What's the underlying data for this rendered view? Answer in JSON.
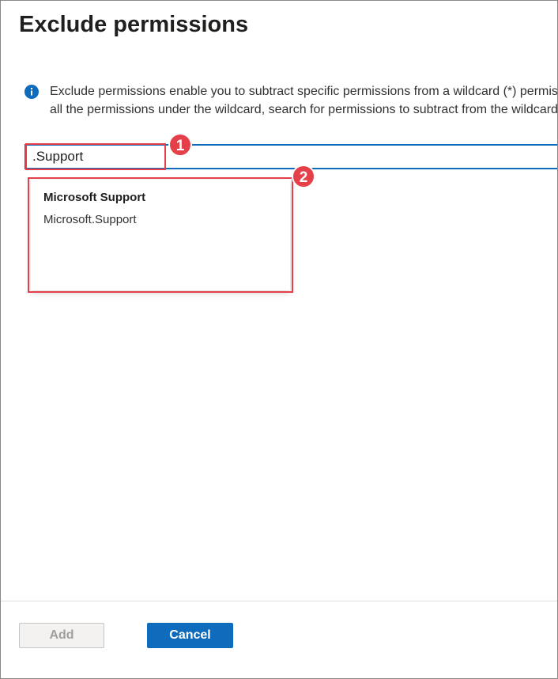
{
  "panel": {
    "title": "Exclude permissions"
  },
  "info": {
    "icon": "info-icon",
    "line1": "Exclude permissions enable you to subtract specific permissions from a wildcard (*) permission. To exclude",
    "line2": "all the permissions under the wildcard, search for permissions to subtract from the wildcard."
  },
  "search": {
    "value": ".Support",
    "placeholder": ""
  },
  "callouts": {
    "badge1": "1",
    "badge2": "2",
    "color": "#e5404a"
  },
  "results": [
    {
      "name": "Microsoft Support",
      "id": "Microsoft.Support"
    }
  ],
  "footer": {
    "add_label": "Add",
    "cancel_label": "Cancel"
  },
  "colors": {
    "accent": "#0f6cbd",
    "callout": "#e5404a"
  }
}
